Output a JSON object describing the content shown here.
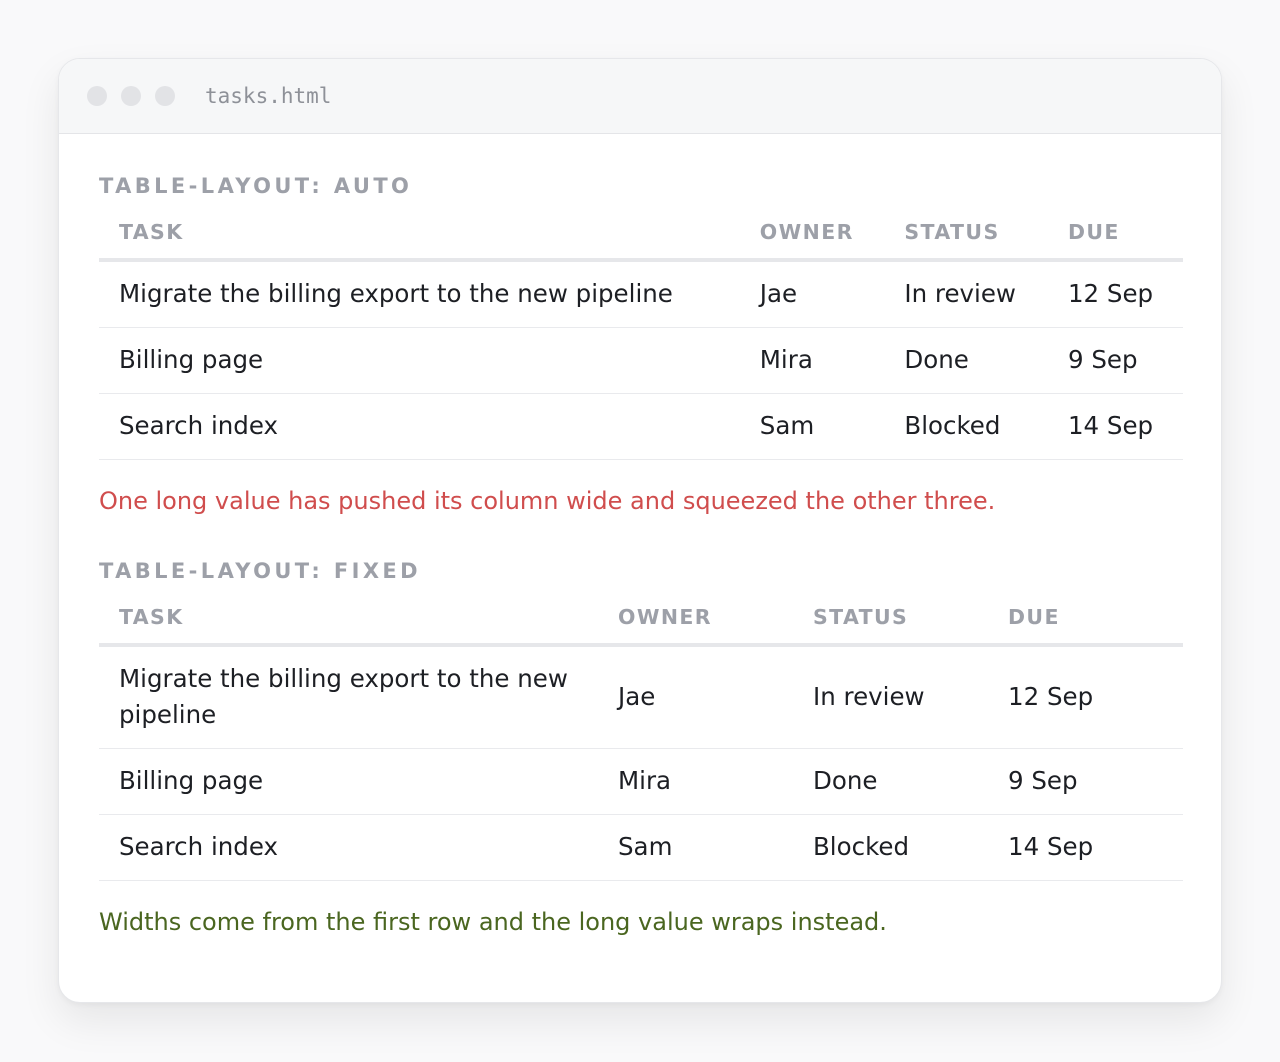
{
  "window": {
    "file_name": "tasks.html"
  },
  "colors": {
    "warning_note": "#d04d4d",
    "success_note": "#4a6620",
    "muted_header": "#9da0a8"
  },
  "auto_section": {
    "title": "TABLE-LAYOUT: AUTO",
    "columns": [
      "TASK",
      "OWNER",
      "STATUS",
      "DUE"
    ],
    "rows": [
      [
        "Migrate the billing export to the new pipeline",
        "Jae",
        "In review",
        "12 Sep"
      ],
      [
        "Billing page",
        "Mira",
        "Done",
        "9 Sep"
      ],
      [
        "Search index",
        "Sam",
        "Blocked",
        "14 Sep"
      ]
    ],
    "note": "One long value has pushed its column wide and squeezed the other three."
  },
  "fixed_section": {
    "title": "TABLE-LAYOUT: FIXED",
    "columns": [
      "TASK",
      "OWNER",
      "STATUS",
      "DUE"
    ],
    "rows": [
      [
        "Migrate the billing export to the new pipeline",
        "Jae",
        "In review",
        "12 Sep"
      ],
      [
        "Billing page",
        "Mira",
        "Done",
        "9 Sep"
      ],
      [
        "Search index",
        "Sam",
        "Blocked",
        "14 Sep"
      ]
    ],
    "note": "Widths come from the first row and the long value wraps instead."
  }
}
